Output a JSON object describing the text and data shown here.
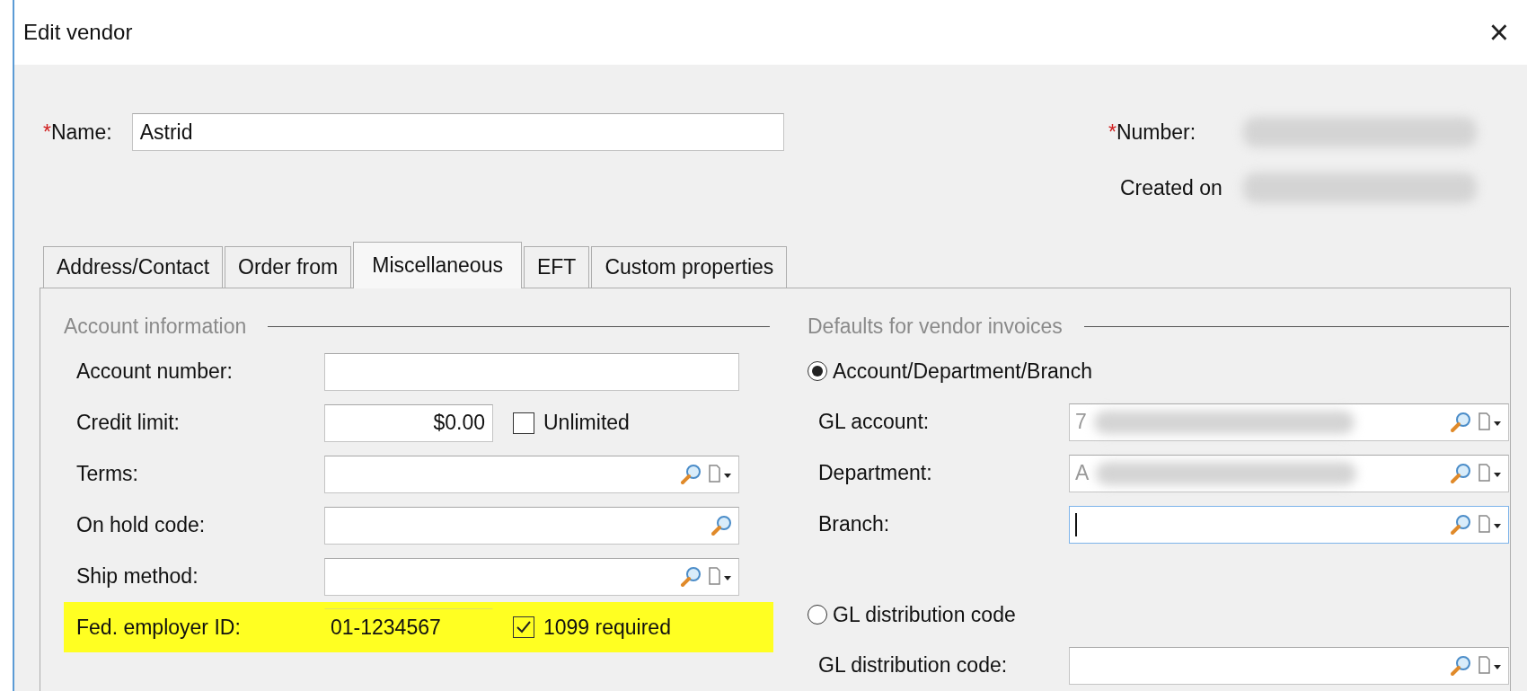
{
  "window": {
    "title": "Edit vendor",
    "close": "×"
  },
  "header": {
    "required_mark": "*",
    "name_label": "Name:",
    "name_value": "Astrid",
    "number_label": "Number:",
    "created_label": "Created on"
  },
  "tabs": [
    {
      "label": "Address/Contact",
      "selected": false
    },
    {
      "label": "Order from",
      "selected": false
    },
    {
      "label": "Miscellaneous",
      "selected": true
    },
    {
      "label": "EFT",
      "selected": false
    },
    {
      "label": "Custom properties",
      "selected": false
    }
  ],
  "account_information": {
    "title": "Account information",
    "rows": [
      {
        "label": "Account number:",
        "kind": "text",
        "highlighted": false
      },
      {
        "label": "Credit limit:",
        "kind": "amount",
        "value": "$0.00",
        "checkbox": {
          "label": "Unlimited",
          "checked": false
        },
        "highlighted": false
      },
      {
        "label": "Terms:",
        "kind": "lookup_menu",
        "highlighted": false
      },
      {
        "label": "On hold code:",
        "kind": "lookup",
        "highlighted": false
      },
      {
        "label": "Ship method:",
        "kind": "lookup_menu",
        "highlighted": false
      },
      {
        "label": "Fed. employer ID:",
        "kind": "amount",
        "value": "01-1234567",
        "checkbox": {
          "label": "1099 required",
          "checked": true
        },
        "highlighted": true
      }
    ]
  },
  "defaults": {
    "title": "Defaults for vendor invoices",
    "options": [
      {
        "label": "Account/Department/Branch",
        "selected": true,
        "fields": [
          {
            "label": "GL account:",
            "value": "7",
            "blurred": true,
            "focused": false
          },
          {
            "label": "Department:",
            "value": "A",
            "blurred": true,
            "focused": false
          },
          {
            "label": "Branch:",
            "blurred": false,
            "focused": true
          }
        ]
      },
      {
        "label": "GL distribution code",
        "selected": false,
        "fields": [
          {
            "label": "GL distribution code:",
            "blurred": false,
            "focused": false
          }
        ]
      }
    ]
  }
}
